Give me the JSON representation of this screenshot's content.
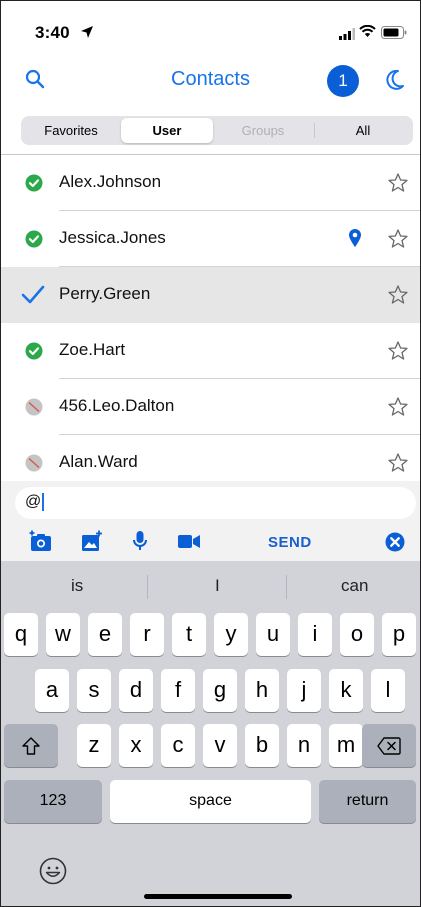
{
  "status_bar": {
    "time": "3:40"
  },
  "nav": {
    "title": "Contacts",
    "badge_count": "1"
  },
  "segments": [
    {
      "label": "Favorites",
      "state": "normal"
    },
    {
      "label": "User",
      "state": "selected"
    },
    {
      "label": "Groups",
      "state": "disabled"
    },
    {
      "label": "All",
      "state": "normal"
    }
  ],
  "contacts": [
    {
      "name": "Alex.Johnson",
      "status": "online",
      "starred": false,
      "located": false,
      "selected": false
    },
    {
      "name": "Jessica.Jones",
      "status": "online",
      "starred": false,
      "located": true,
      "selected": false
    },
    {
      "name": "Perry.Green",
      "status": "checked",
      "starred": false,
      "located": false,
      "selected": true
    },
    {
      "name": "Zoe.Hart",
      "status": "online",
      "starred": false,
      "located": false,
      "selected": false
    },
    {
      "name": "456.Leo.Dalton",
      "status": "offline",
      "starred": false,
      "located": false,
      "selected": false
    },
    {
      "name": "Alan.Ward",
      "status": "offline",
      "starred": false,
      "located": false,
      "selected": false
    }
  ],
  "compose": {
    "value": "@",
    "send_label": "SEND",
    "toolbar_icons": [
      "camera-icon",
      "photo-library-icon",
      "microphone-icon",
      "video-camera-icon",
      "clear-icon"
    ]
  },
  "keyboard": {
    "predictions": [
      "is",
      "I",
      "can"
    ],
    "row1": [
      "q",
      "w",
      "e",
      "r",
      "t",
      "y",
      "u",
      "i",
      "o",
      "p"
    ],
    "row2": [
      "a",
      "s",
      "d",
      "f",
      "g",
      "h",
      "j",
      "k",
      "l"
    ],
    "row3": [
      "z",
      "x",
      "c",
      "v",
      "b",
      "n",
      "m"
    ],
    "numbers_label": "123",
    "space_label": "space",
    "return_label": "return"
  },
  "colors": {
    "accent": "#1a73e8",
    "badge": "#0a5fd6",
    "online": "#2aa84a",
    "offline": "#b8b8b8",
    "selected_row": "#e6e6e6",
    "keyboard_bg": "#d1d3d9"
  }
}
